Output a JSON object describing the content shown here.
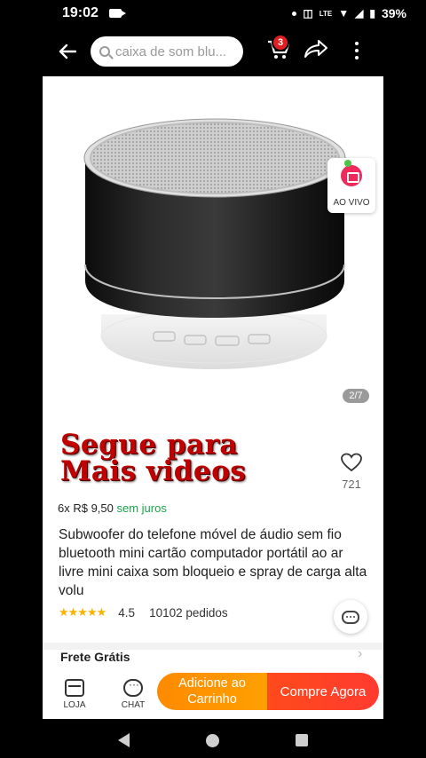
{
  "status_bar": {
    "time": "19:02",
    "network_label": "LTE",
    "battery": "39%"
  },
  "top_nav": {
    "search_placeholder": "caixa de som blu...",
    "cart_badge": "3"
  },
  "product": {
    "live_label": "AO VIVO",
    "image_pager": "2/7",
    "overlay_caption_line1": "Segue para",
    "overlay_caption_line2": "Mais videos",
    "likes": "721",
    "installments_prefix": "6x R$ 9,50",
    "installments_suffix": "sem juros",
    "title": "Subwoofer do telefone móvel de áudio sem fio bluetooth mini cartão computador portátil ao ar livre mini caixa som bloqueio e spray de carga alta volu",
    "rating_stars": "★★★★★",
    "rating": "4.5",
    "orders": "10102 pedidos",
    "shipping": "Frete Grátis"
  },
  "bottom_bar": {
    "store_label": "LOJA",
    "chat_label": "CHAT",
    "add_to_cart": "Adicione ao Carrinho",
    "buy_now": "Compre Agora"
  },
  "colors": {
    "accent_orange": "#ff9500",
    "buy_red": "#ff4020",
    "caption_red": "#c00000",
    "installment_green": "#1aa34a",
    "star_yellow": "#f6b400"
  }
}
